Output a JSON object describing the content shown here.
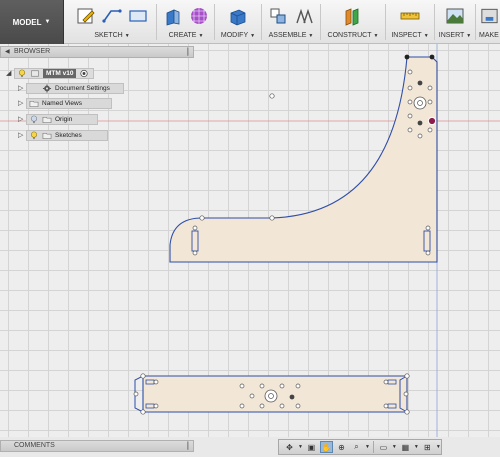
{
  "toolbar": {
    "mode_label": "MODEL",
    "groups": {
      "sketch": "SKETCH",
      "create": "CREATE",
      "modify": "MODIFY",
      "assemble": "ASSEMBLE",
      "construct": "CONSTRUCT",
      "inspect": "INSPECT",
      "insert": "INSERT",
      "make": "MAKE"
    }
  },
  "browser": {
    "title": "BROWSER",
    "root": {
      "name": "MTM v10"
    },
    "items": [
      {
        "label": "Document Settings",
        "icon": "gear-icon"
      },
      {
        "label": "Named Views",
        "icon": "folder-icon"
      },
      {
        "label": "Origin",
        "icon": "folder-icon"
      },
      {
        "label": "Sketches",
        "icon": "folder-icon"
      }
    ]
  },
  "comments": {
    "title": "COMMENTS"
  },
  "colors": {
    "sketch_line": "#2f4ea6",
    "profile_fill": "#f2e6d6",
    "accent": "#4a7fc1"
  },
  "navbar": {
    "icons": [
      "orbit-icon",
      "look-at-icon",
      "pan-icon",
      "zoom-icon",
      "fit-icon",
      "display-settings-icon",
      "visual-style-icon",
      "grid-settings-icon"
    ]
  }
}
